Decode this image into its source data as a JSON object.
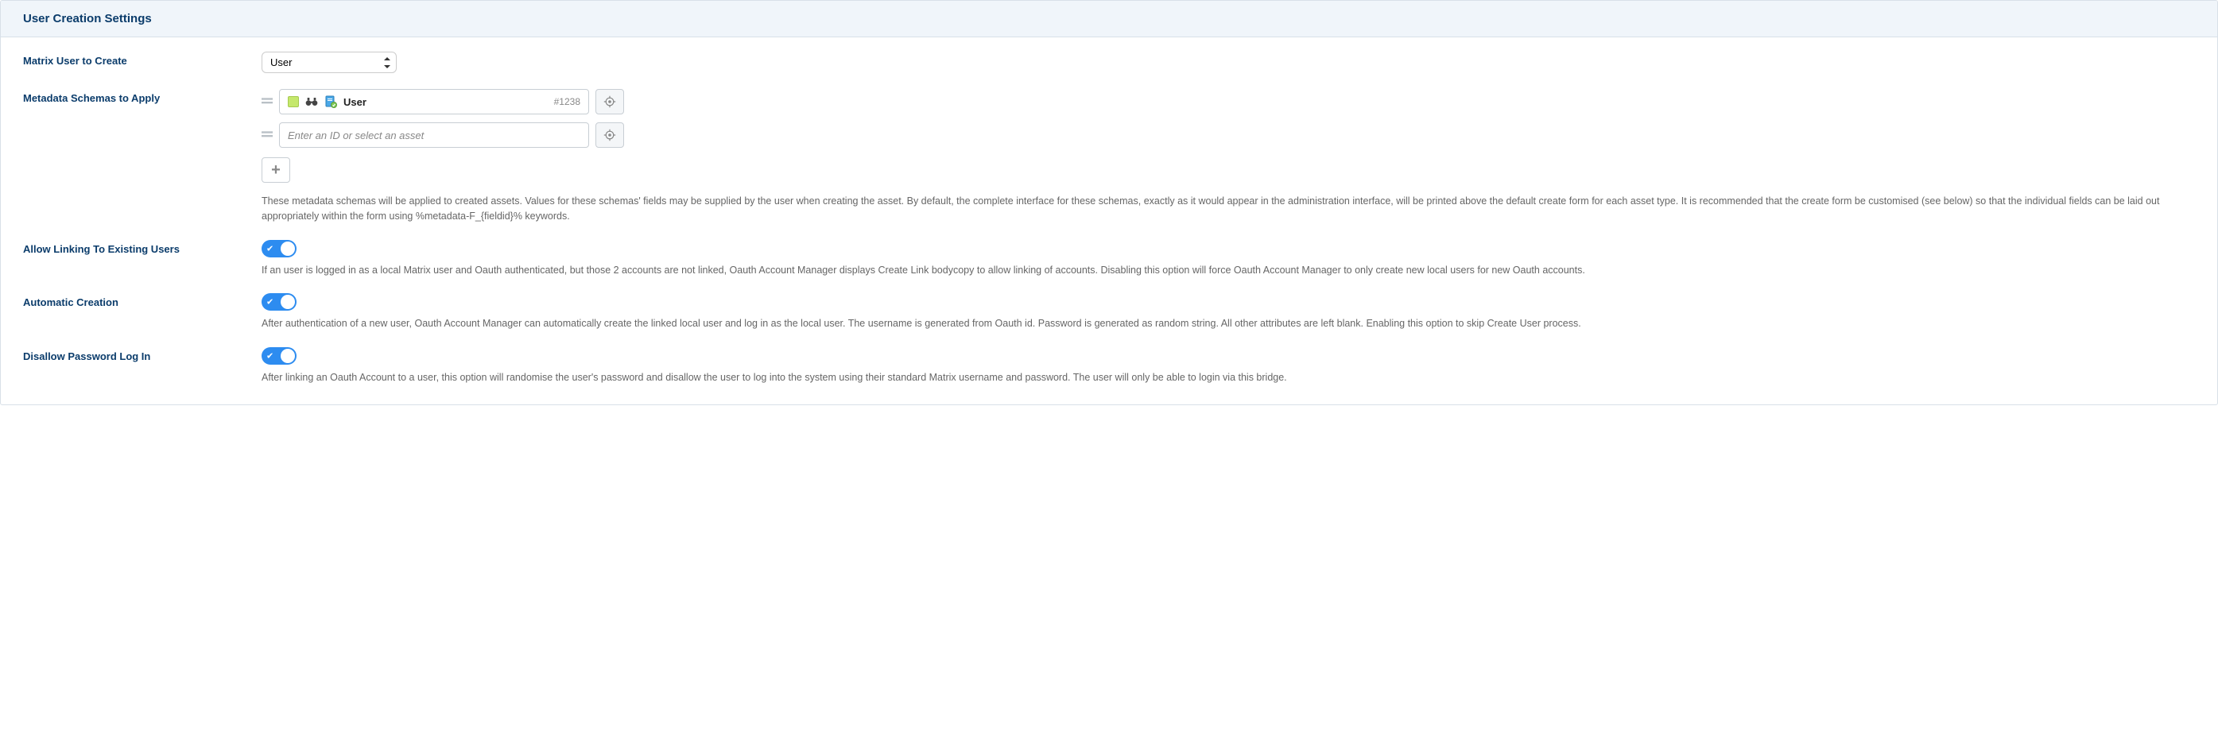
{
  "header": {
    "title": "User Creation Settings"
  },
  "fields": {
    "matrix_user": {
      "label": "Matrix User to Create",
      "selected": "User"
    },
    "metadata": {
      "label": "Metadata Schemas to Apply",
      "item_name": "User",
      "item_id": "#1238",
      "placeholder": "Enter an ID or select an asset",
      "help": "These metadata schemas will be applied to created assets. Values for these schemas' fields may be supplied by the user when creating the asset. By default, the complete interface for these schemas, exactly as it would appear in the administration interface, will be printed above the default create form for each asset type. It is recommended that the create form be customised (see below) so that the individual fields can be laid out appropriately within the form using %metadata-F_{fieldid}% keywords."
    },
    "allow_linking": {
      "label": "Allow Linking To Existing Users",
      "help": "If an user is logged in as a local Matrix user and Oauth authenticated, but those 2 accounts are not linked, Oauth Account Manager displays Create Link bodycopy to allow linking of accounts. Disabling this option will force Oauth Account Manager to only create new local users for new Oauth accounts."
    },
    "automatic_creation": {
      "label": "Automatic Creation",
      "help": "After authentication of a new user, Oauth Account Manager can automatically create the linked local user and log in as the local user. The username is generated from Oauth id. Password is generated as random string. All other attributes are left blank. Enabling this option to skip Create User process."
    },
    "disallow_password": {
      "label": "Disallow Password Log In",
      "help": "After linking an Oauth Account to a user, this option will randomise the user's password and disallow the user to log into the system using their standard Matrix username and password. The user will only be able to login via this bridge."
    }
  }
}
